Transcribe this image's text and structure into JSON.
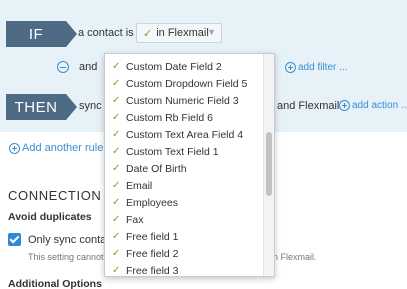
{
  "rule": {
    "if_tag": "IF",
    "then_tag": "THEN",
    "contact_is_label": "a contact is",
    "condition_value": "in Flexmail",
    "and_label": "and",
    "add_filter_label": "add filter ...",
    "sync_label": "sync t",
    "and_flexmail_label": "and Flexmail",
    "add_action_label": "add action ...",
    "add_rule_label": "Add another rule ..."
  },
  "section": {
    "title": "CONNECTION",
    "avoid_duplicates_label": "Avoid duplicates",
    "only_sync_label": "Only sync contac",
    "note_left": "This setting cannot",
    "note_right": "n Flexmail.",
    "additional_options_label": "Additional Options"
  },
  "dropdown": {
    "items": [
      "Custom Date Field 2",
      "Custom Dropdown Field 5",
      "Custom Numeric Field 3",
      "Custom Rb Field 6",
      "Custom Text Area Field 4",
      "Custom Text Field 1",
      "Date Of Birth",
      "Email",
      "Employees",
      "Fax",
      "Free field 1",
      "Free field 2",
      "Free field 3"
    ]
  },
  "icons": {
    "check": "check-icon",
    "caret": "chevron-down-icon",
    "remove": "minus-circle-icon",
    "add": "plus-circle-icon"
  },
  "colors": {
    "panel_bg": "#e6f1f8",
    "tag_bg": "#4e6a85",
    "link": "#3a8fd0",
    "check_green": "#6aa63b",
    "checkbox_blue": "#2e8ad8"
  }
}
